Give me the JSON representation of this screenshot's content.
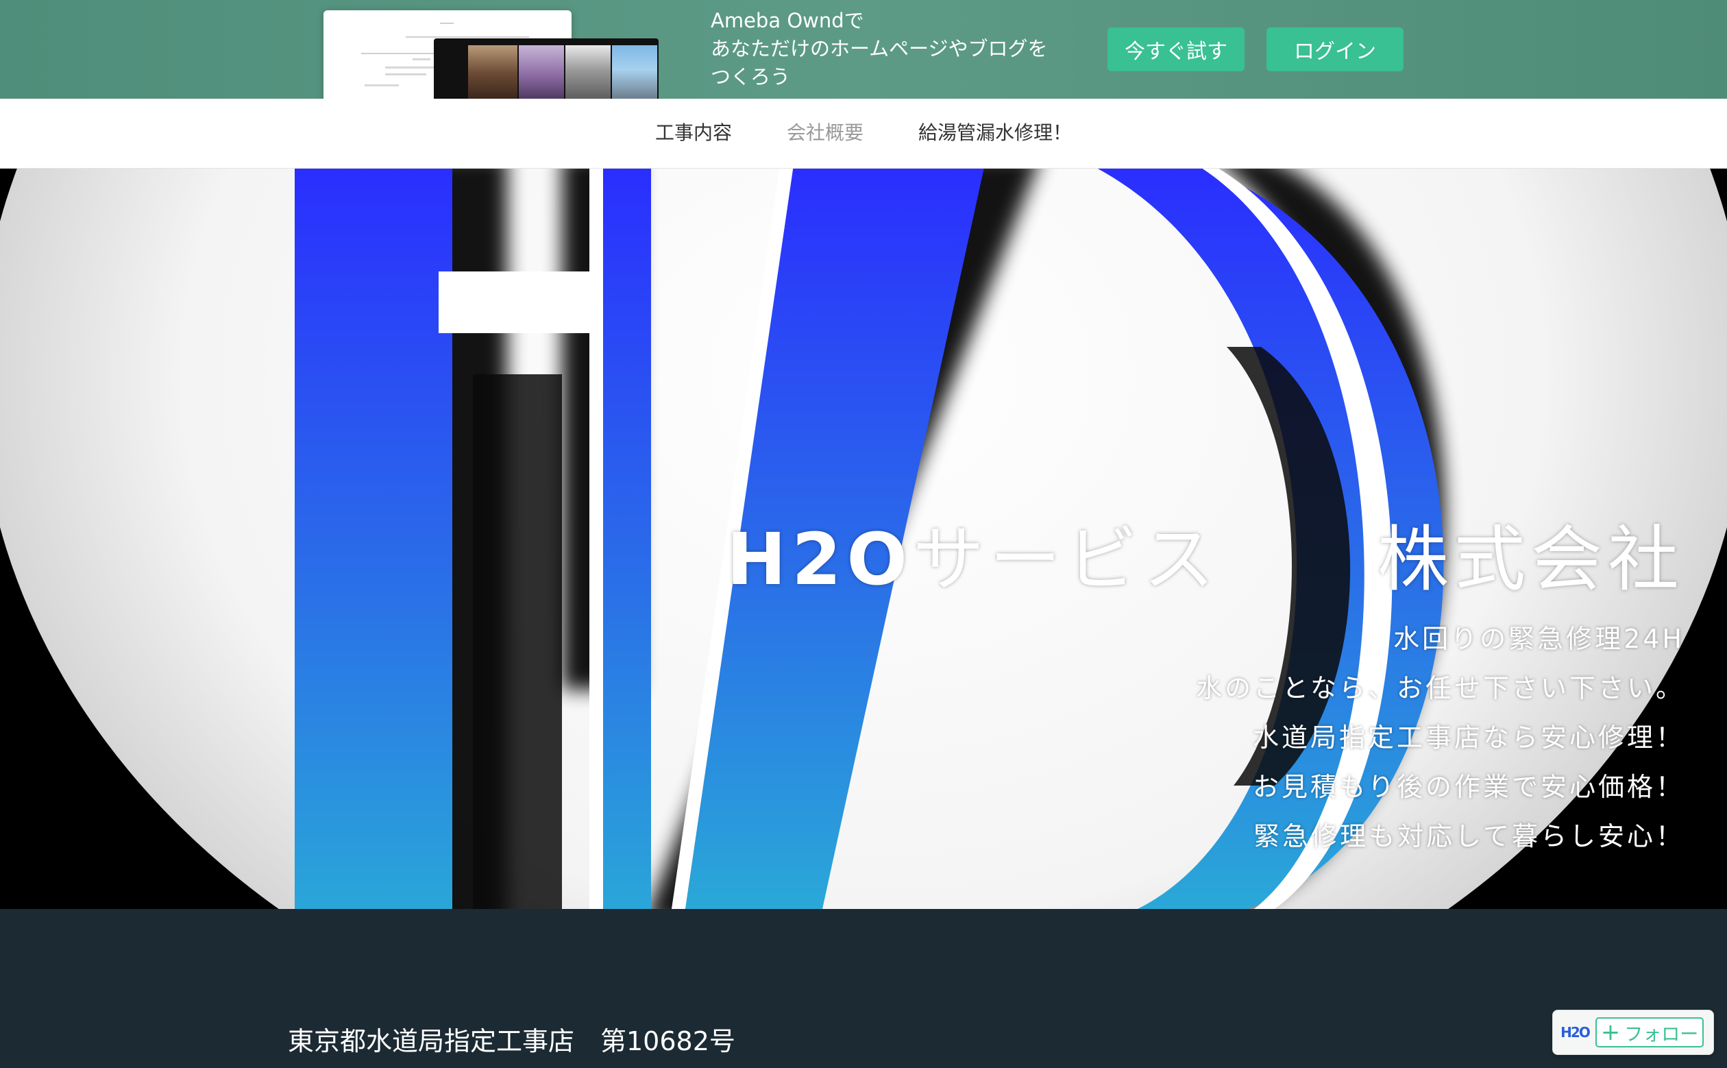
{
  "promo": {
    "line1": "Ameba Owndで",
    "line2": "あなただけのホームページやブログを",
    "line3": "つくろう",
    "try_button": "今すぐ試す",
    "login_button": "ログイン"
  },
  "nav": {
    "items": [
      {
        "label": "工事内容"
      },
      {
        "label": "会社概要"
      },
      {
        "label": "給湯管漏水修理！"
      }
    ]
  },
  "hero": {
    "title_latin": "H2O",
    "title_kana": "サービス",
    "title_company": "株式会社",
    "lines": [
      "水回りの緊急修理24H",
      "水のことなら、お任せ下さい下さい。",
      "水道局指定工事店なら安心修理！",
      "お見積もり後の作業で安心価格！",
      "緊急修理も対応して暮らし安心！"
    ]
  },
  "info": {
    "registration": "東京都水道局指定工事店　第10682号"
  },
  "follow": {
    "logo_text": "H2O",
    "label": "フォロー"
  },
  "colors": {
    "promo_bg": "#5d9b87",
    "accent": "#39c093",
    "dark_bg": "#1c2a33",
    "logo_blue": "#2a5fd8"
  }
}
